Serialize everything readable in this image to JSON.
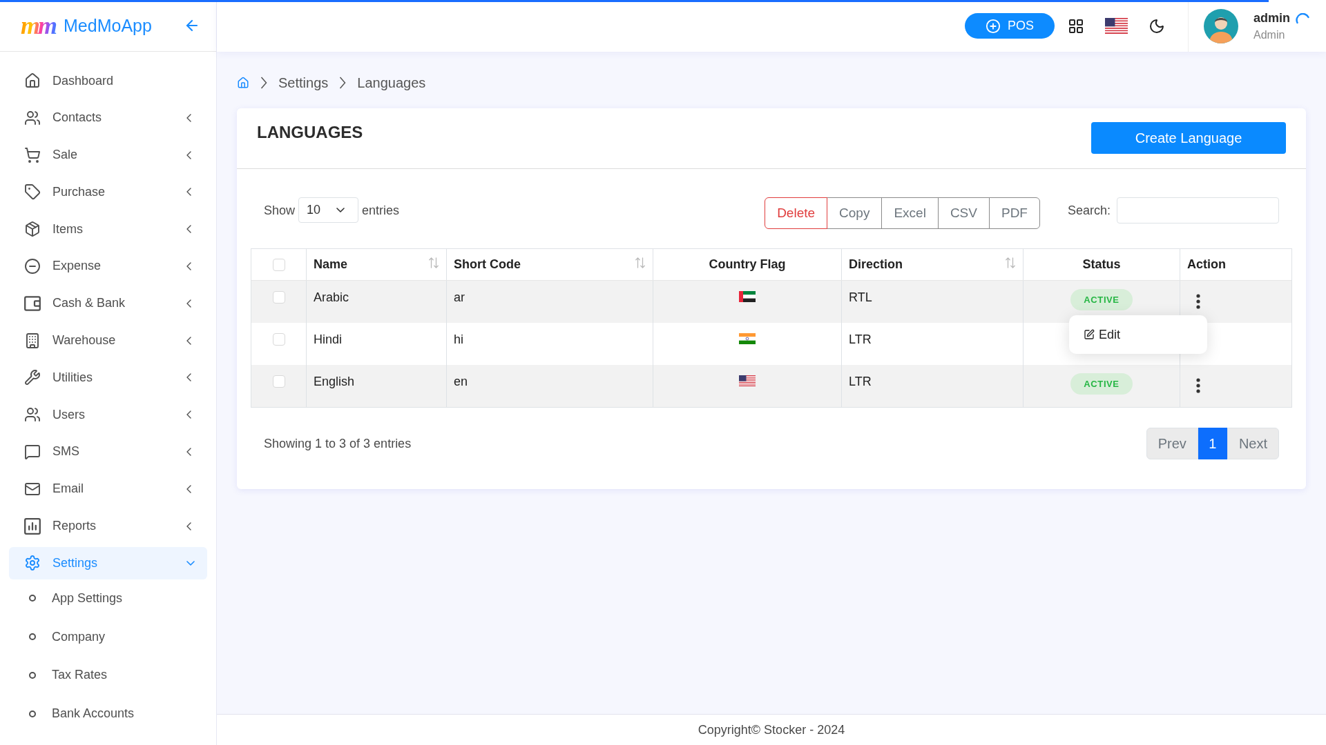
{
  "loading_bar": {
    "level": 0.957
  },
  "sidebar": {
    "logo": {
      "mark": "mm",
      "name": "MedMoApp"
    },
    "items": [
      {
        "kind": "link",
        "label": "Dashboard",
        "selected": false
      },
      {
        "kind": "group",
        "label": "Contacts",
        "selected": false,
        "expanded": false
      },
      {
        "kind": "group",
        "label": "Sale",
        "selected": false,
        "expanded": false
      },
      {
        "kind": "group",
        "label": "Purchase",
        "selected": false,
        "expanded": false
      },
      {
        "kind": "group",
        "label": "Items",
        "selected": false,
        "expanded": false
      },
      {
        "kind": "group",
        "label": "Expense",
        "selected": false,
        "expanded": false
      },
      {
        "kind": "group",
        "label": "Cash & Bank",
        "selected": false,
        "expanded": false
      },
      {
        "kind": "group",
        "label": "Warehouse",
        "selected": false,
        "expanded": false
      },
      {
        "kind": "group",
        "label": "Utilities",
        "selected": false,
        "expanded": false
      },
      {
        "kind": "group",
        "label": "Users",
        "selected": false,
        "expanded": false
      },
      {
        "kind": "group",
        "label": "SMS",
        "selected": false,
        "expanded": false
      },
      {
        "kind": "group",
        "label": "Email",
        "selected": false,
        "expanded": false
      },
      {
        "kind": "group",
        "label": "Reports",
        "selected": false,
        "expanded": false
      },
      {
        "kind": "group",
        "label": "Settings",
        "selected": true,
        "expanded": true,
        "children": [
          {
            "label": "App Settings",
            "selected": false
          },
          {
            "label": "Company",
            "selected": false
          },
          {
            "label": "Tax Rates",
            "selected": false
          },
          {
            "label": "Bank Accounts",
            "selected": false
          }
        ]
      }
    ]
  },
  "header": {
    "pos_label": "POS",
    "language_flag": {
      "kind": "us"
    },
    "user": {
      "name": "admin",
      "role": "Admin"
    }
  },
  "breadcrumb": [
    "Settings",
    "Languages"
  ],
  "page": {
    "title": "LANGUAGES",
    "create_button": "Create Language",
    "length_menu": {
      "show_label": "Show",
      "value": "10",
      "entries_label": "entries"
    },
    "export_buttons": [
      {
        "kind": "danger",
        "label": "Delete"
      },
      {
        "kind": "default",
        "label": "Copy"
      },
      {
        "kind": "default",
        "label": "Excel"
      },
      {
        "kind": "default",
        "label": "CSV"
      },
      {
        "kind": "default",
        "label": "PDF"
      }
    ],
    "search": {
      "label": "Search:"
    },
    "table": {
      "columns": [
        {
          "kind": "select",
          "checked": false
        },
        {
          "kind": "name",
          "label": "Name",
          "sortable": true
        },
        {
          "kind": "short_code",
          "label": "Short Code",
          "sortable": true
        },
        {
          "kind": "flag",
          "label": "Country Flag",
          "sortable": false
        },
        {
          "kind": "direction",
          "label": "Direction",
          "sortable": true
        },
        {
          "kind": "status",
          "label": "Status",
          "sortable": false
        },
        {
          "kind": "action",
          "label": "Action",
          "sortable": false
        }
      ],
      "rows": [
        {
          "checked": false,
          "name": "Arabic",
          "short_code": "ar",
          "flag": {
            "kind": "ae"
          },
          "direction": "RTL",
          "status": "ACTIVE",
          "action_menu": {
            "items": [
              {
                "label": "Edit"
              }
            ]
          }
        },
        {
          "checked": false,
          "name": "Hindi",
          "short_code": "hi",
          "flag": {
            "kind": "in"
          },
          "direction": "LTR"
        },
        {
          "checked": false,
          "name": "English",
          "short_code": "en",
          "flag": {
            "kind": "us"
          },
          "direction": "LTR",
          "status": "ACTIVE"
        }
      ]
    },
    "info": "Showing 1 to 3 of 3 entries",
    "pagination": {
      "prev": {
        "label": "Prev",
        "disabled": true
      },
      "pages": [
        {
          "label": "1",
          "selected": true
        }
      ],
      "next": {
        "label": "Next",
        "disabled": true
      }
    }
  },
  "footer": "Copyright© Stocker - 2024"
}
